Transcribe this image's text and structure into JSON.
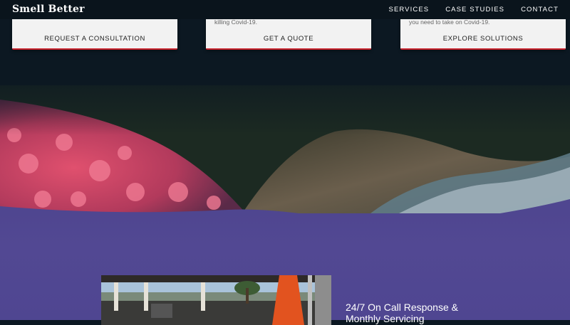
{
  "header": {
    "logo": "Smell Better",
    "nav": [
      "SERVICES",
      "CASE STUDIES",
      "CONTACT"
    ]
  },
  "cards": [
    {
      "snippet": "",
      "cta": "REQUEST A CONSULTATION"
    },
    {
      "snippet": "killing Covid-19.",
      "cta": "GET A QUOTE"
    },
    {
      "snippet": "you need to take on Covid-19.",
      "cta": "EXPLORE SOLUTIONS"
    }
  ],
  "feature": {
    "heading": "24/7 On Call Response & Monthly Servicing"
  },
  "colors": {
    "nav_bg": "#0a141c",
    "dark_bg": "#0c1822",
    "purple": "#4f4690",
    "card_bg": "#f2f2f2",
    "card_accent": "#c8202b"
  }
}
